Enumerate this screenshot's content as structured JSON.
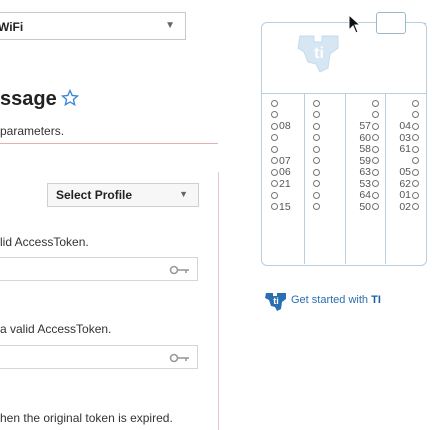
{
  "wifi": {
    "value": "WiFi"
  },
  "message": {
    "title": "ssage",
    "description": "parameters."
  },
  "profile": {
    "value": "Select Profile"
  },
  "notes": {
    "note1": "lid AccessToken.",
    "note2": "a valid AccessToken.",
    "note3": "hen the original token is expired."
  },
  "board": {
    "col1": [
      "",
      "",
      "08",
      "",
      "",
      "07",
      "06",
      "21",
      "",
      "15"
    ],
    "col2": [
      "",
      "",
      "",
      "",
      "",
      "",
      "",
      "",
      "",
      ""
    ],
    "col3": [
      "",
      "",
      "57",
      "60",
      "58",
      "59",
      "63",
      "53",
      "64",
      "50"
    ],
    "col4": [
      "",
      "",
      "04",
      "03",
      "61",
      "",
      "05",
      "62",
      "01",
      "02"
    ]
  },
  "links": {
    "get_started_prefix": "Get started with ",
    "get_started_brand": "TI"
  },
  "colors": {
    "ti_blue": "#2a6fb0",
    "board_line": "#b8cfe0"
  }
}
